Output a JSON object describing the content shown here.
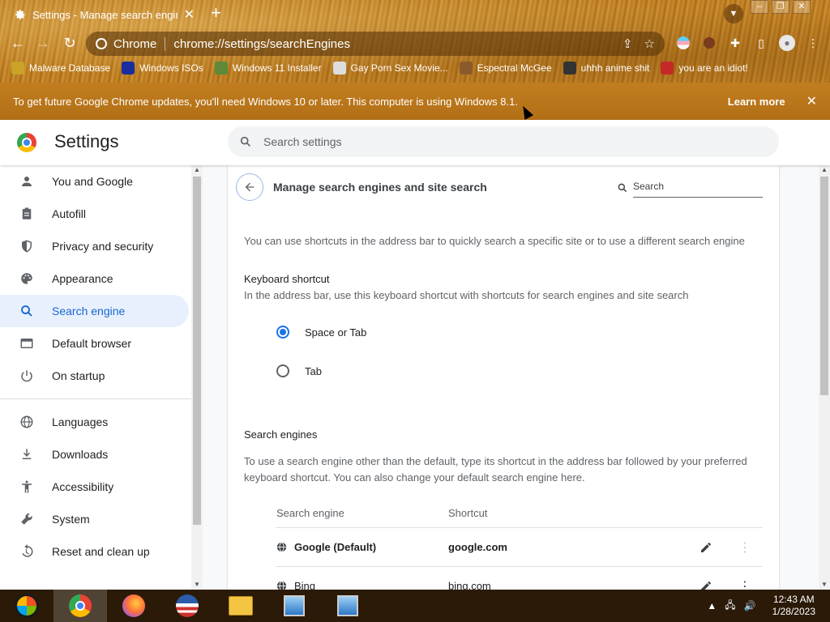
{
  "browser": {
    "tab_title": "Settings - Manage search engines",
    "omnibox_site": "Chrome",
    "omnibox_url": "chrome://settings/searchEngines",
    "bookmarks": [
      {
        "label": "Malware Database",
        "color": "#c9a227"
      },
      {
        "label": "Windows ISOs",
        "color": "#1a2e9e"
      },
      {
        "label": "Windows 11 Installer",
        "color": "#5c8a3a"
      },
      {
        "label": "Gay Porn Sex Movie...",
        "color": "#dddddd"
      },
      {
        "label": "Espectral McGee",
        "color": "#8a5a2a"
      },
      {
        "label": "uhhh anime shit",
        "color": "#333333"
      },
      {
        "label": "you are an idiot!",
        "color": "#c62828"
      }
    ]
  },
  "infobar": {
    "message": "To get future Google Chrome updates, you'll need Windows 10 or later. This computer is using Windows 8.1.",
    "learn_more": "Learn more"
  },
  "settings": {
    "title": "Settings",
    "search_placeholder": "Search settings"
  },
  "sidebar": {
    "items": [
      {
        "label": "You and Google",
        "icon": "person-icon"
      },
      {
        "label": "Autofill",
        "icon": "clipboard-icon"
      },
      {
        "label": "Privacy and security",
        "icon": "shield-icon"
      },
      {
        "label": "Appearance",
        "icon": "palette-icon"
      },
      {
        "label": "Search engine",
        "icon": "search-icon",
        "active": true
      },
      {
        "label": "Default browser",
        "icon": "browser-window-icon"
      },
      {
        "label": "On startup",
        "icon": "power-icon"
      }
    ],
    "items2": [
      {
        "label": "Languages",
        "icon": "globe-icon"
      },
      {
        "label": "Downloads",
        "icon": "download-icon"
      },
      {
        "label": "Accessibility",
        "icon": "accessibility-icon"
      },
      {
        "label": "System",
        "icon": "wrench-icon"
      },
      {
        "label": "Reset and clean up",
        "icon": "restore-icon"
      }
    ]
  },
  "page": {
    "title": "Manage search engines and site search",
    "search_placeholder": "Search",
    "intro": "You can use shortcuts in the address bar to quickly search a specific site or to use a different search engine",
    "keyboard_heading": "Keyboard shortcut",
    "keyboard_desc": "In the address bar, use this keyboard shortcut with shortcuts for search engines and site search",
    "options": [
      {
        "label": "Space or Tab",
        "selected": true
      },
      {
        "label": "Tab",
        "selected": false
      }
    ],
    "engines_heading": "Search engines",
    "engines_desc": "To use a search engine other than the default, type its shortcut in the address bar followed by your preferred keyboard shortcut. You can also change your default search engine here.",
    "table": {
      "col_engine": "Search engine",
      "col_shortcut": "Shortcut",
      "rows": [
        {
          "name": "Google (Default)",
          "shortcut": "google.com"
        },
        {
          "name": "Bing",
          "shortcut": "bing.com"
        }
      ]
    }
  },
  "taskbar": {
    "time": "12:43 AM",
    "date": "1/28/2023"
  },
  "colors": {
    "accent": "#1a73e8",
    "active_nav_bg": "#e8f0fe",
    "frame": "#b87a22"
  }
}
